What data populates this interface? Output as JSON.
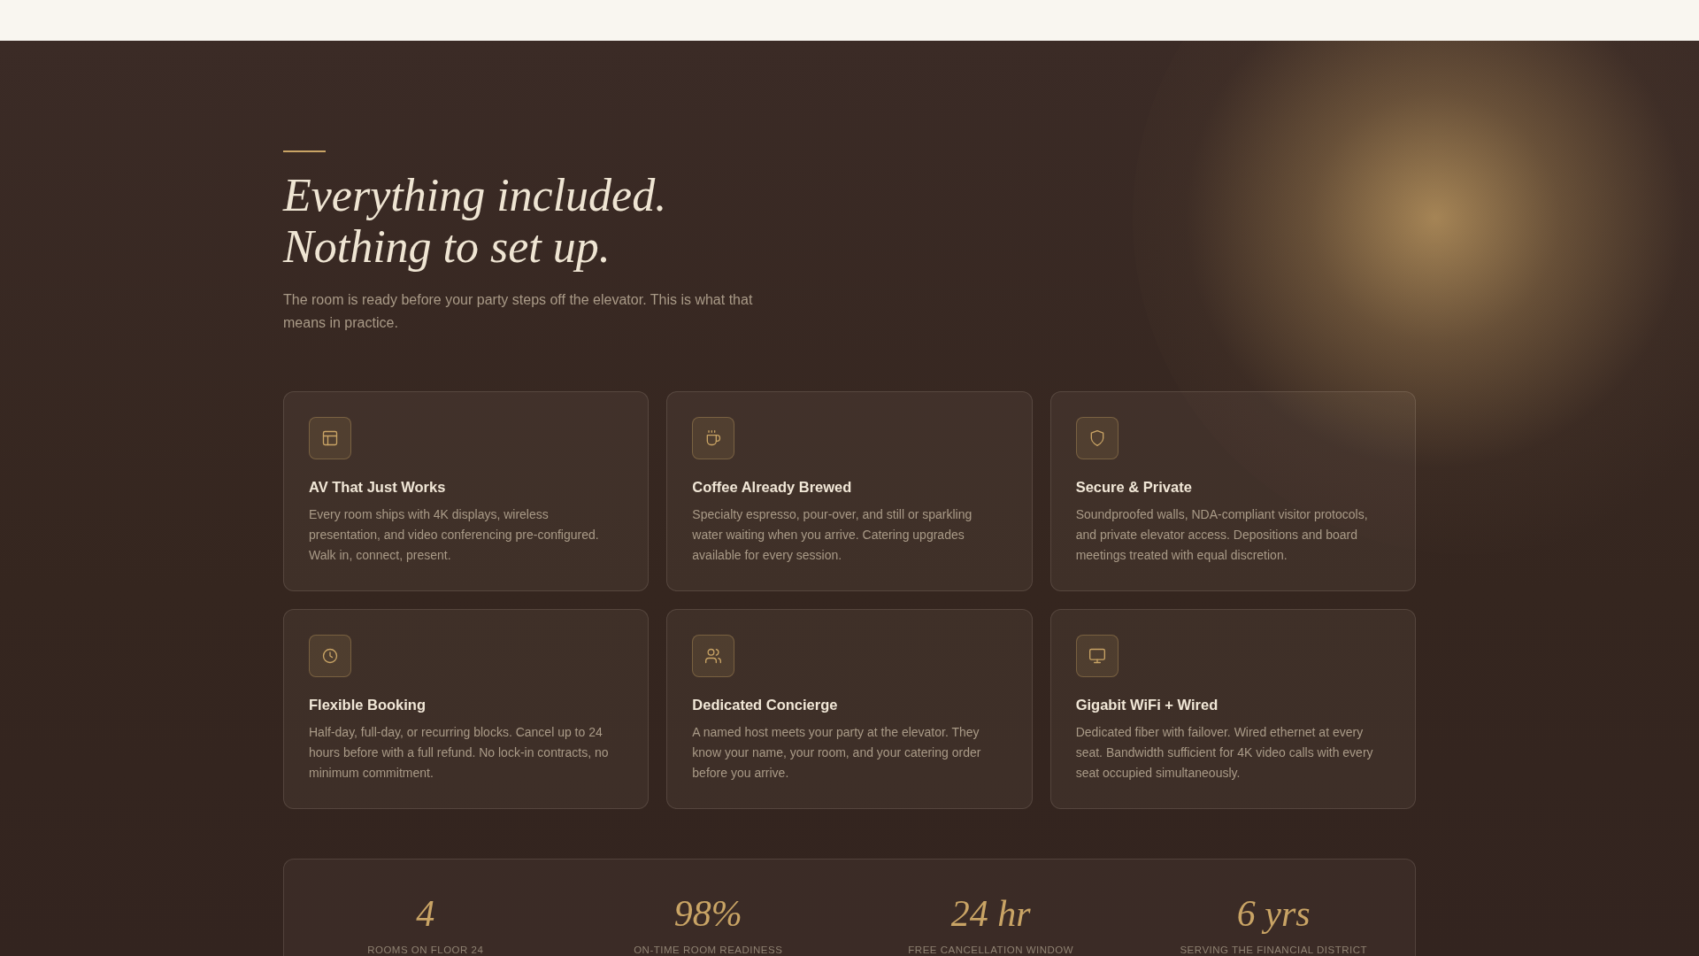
{
  "heading": {
    "lines": [
      "Everything included.",
      "Nothing to set up."
    ],
    "intro": "The room is ready before your party steps off the elevator. This is what that means in practice."
  },
  "features": [
    {
      "title": "AV That Just Works",
      "text": "Every room ships with 4K displays, wireless presentation, and video conferencing pre-configured. Walk in, connect, present."
    },
    {
      "title": "Coffee Already Brewed",
      "text": "Specialty espresso, pour-over, and still or sparkling water waiting when you arrive. Catering upgrades available for every session."
    },
    {
      "title": "Secure & Private",
      "text": "Soundproofed walls, NDA-compliant visitor protocols, and private elevator access. Depositions and board meetings treated with equal discretion."
    },
    {
      "title": "Flexible Booking",
      "text": "Half-day, full-day, or recurring blocks. Cancel up to 24 hours before with a full refund. No lock-in contracts, no minimum commitment."
    },
    {
      "title": "Dedicated Concierge",
      "text": "A named host meets your party at the elevator. They know your name, your room, and your catering order before you arrive."
    },
    {
      "title": "Gigabit WiFi + Wired",
      "text": "Dedicated fiber with failover. Wired ethernet at every seat. Bandwidth sufficient for 4K video calls with every seat occupied simultaneously."
    }
  ],
  "stats": [
    {
      "value": "4",
      "label": "ROOMS ON FLOOR 24"
    },
    {
      "value": "98%",
      "label": "ON-TIME ROOM READINESS"
    },
    {
      "value": "24 hr",
      "label": "FREE CANCELLATION WINDOW"
    },
    {
      "value": "6 yrs",
      "label": "SERVING THE FINANCIAL DISTRICT"
    }
  ]
}
